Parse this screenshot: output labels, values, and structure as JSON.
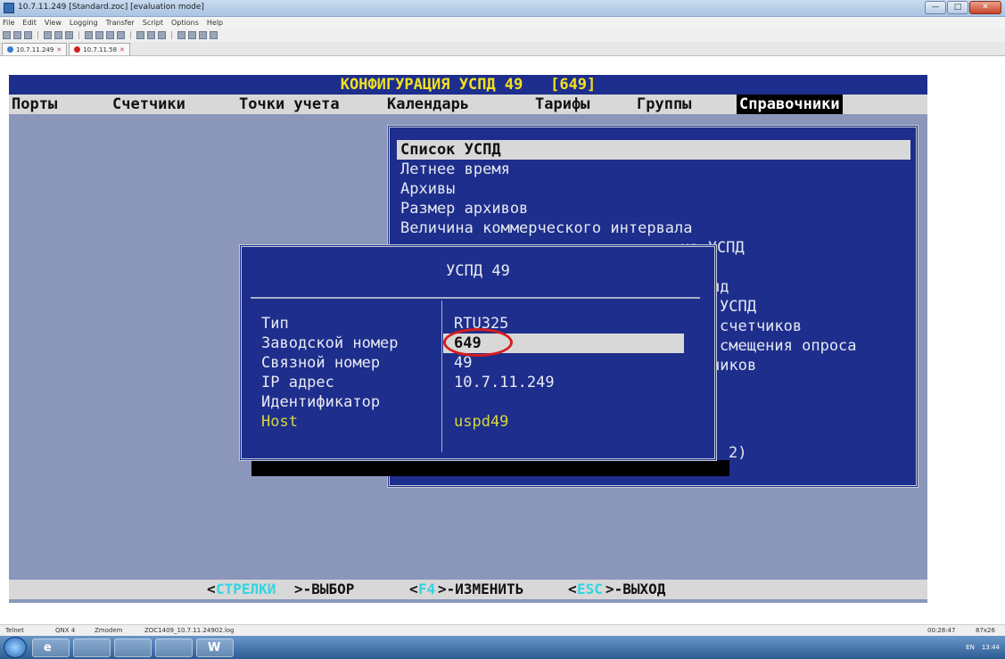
{
  "window": {
    "title": "10.7.11.249 [Standard.zoc] [evaluation mode]",
    "buttons": [
      "—",
      "□",
      "✕"
    ]
  },
  "menubar": [
    "File",
    "Edit",
    "View",
    "Logging",
    "Transfer",
    "Script",
    "Options",
    "Help"
  ],
  "session_tabs": [
    {
      "label": "10.7.11.249",
      "status_color": "#3a7ad0"
    },
    {
      "label": "10.7.11.58",
      "status_color": "#d02020"
    }
  ],
  "terminal": {
    "title": "КОНФИГУРАЦИЯ УСПД 49   [649]",
    "menu": [
      "Порты",
      "Счетчики",
      "Точки учета",
      "Календарь",
      "Тарифы",
      "Группы",
      "Справочники"
    ],
    "active_menu": "Справочники",
    "dropdown_items": [
      "Список УСПД",
      "Летнее время",
      "Архивы",
      "Размер архивов",
      "Величина коммерческого интервала"
    ],
    "dropdown_partial_items": [
      "на УСПД",
      "пд",
      "УСПД",
      "счетчиков",
      "смещения опроса",
      "чиков",
      "2)"
    ],
    "popup": {
      "title": "УСПД 49",
      "fields": [
        {
          "label": "Тип",
          "value": "RTU325"
        },
        {
          "label": "Заводской номер",
          "value": "649"
        },
        {
          "label": "Связной номер",
          "value": "49"
        },
        {
          "label": "IP адрес",
          "value": "10.7.11.249"
        },
        {
          "label": "Идентификатор",
          "value": ""
        },
        {
          "label": "Host",
          "value": "uspd49"
        }
      ]
    },
    "statusbar": {
      "k1_open": "<",
      "k1_key": "СТРЕЛКИ",
      "k1_text": ">-ВЫБОР",
      "k2_open": "<",
      "k2_key": "F4",
      "k2_text": ">-ИЗМЕНИТЬ",
      "k3_open": "<",
      "k3_key": "ESC",
      "k3_text": ">-ВЫХОД"
    },
    "colors": {
      "background": "#8b96bb",
      "panel": "#1d2e8c",
      "menu_bar": "#d8d8d8",
      "title_text": "#f3e11f",
      "host_text": "#d7d73a",
      "status_key": "#2fd6e0",
      "highlight_circle": "#d61c1c"
    }
  },
  "app_status": {
    "items": [
      "Telnet",
      "QNX 4",
      "Zmodem",
      "ZOC1409_10.7.11.24902.log"
    ],
    "time": "00:28:47",
    "size": "87x26"
  },
  "taskbar": {
    "apps": [
      "ie-icon",
      "folder-icon",
      "media-icon",
      "terminal-icon",
      "word-icon"
    ],
    "tray_lang": "EN",
    "clock": "13:44"
  }
}
